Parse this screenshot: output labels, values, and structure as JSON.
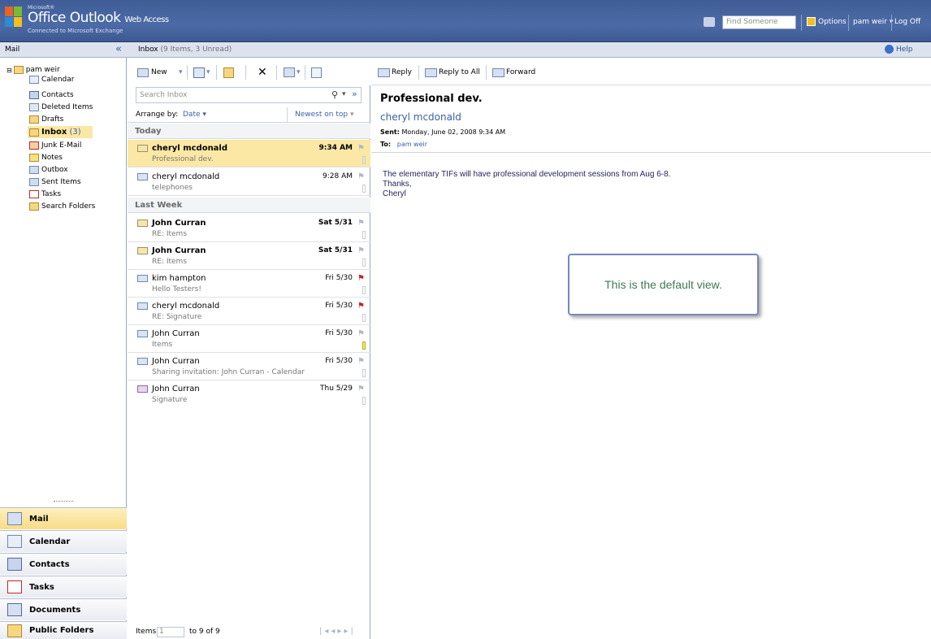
{
  "app": {
    "ms_label": "Microsoft®",
    "title_main": "Office Outlook",
    "title_sub": "Web Access",
    "connected": "Connected to Microsoft Exchange",
    "find_placeholder": "Find Someone",
    "options": "Options",
    "user": "pam weir",
    "logoff": "Log Off",
    "help": "Help"
  },
  "sidebar": {
    "header": "Mail",
    "collapse_glyph": "«",
    "root": "pam weir",
    "folders": [
      {
        "label": "Calendar"
      },
      {
        "label": "Contacts"
      },
      {
        "label": "Deleted Items"
      },
      {
        "label": "Drafts"
      },
      {
        "label": "Inbox",
        "count": "(3)"
      },
      {
        "label": "Junk E-Mail"
      },
      {
        "label": "Notes"
      },
      {
        "label": "Outbox"
      },
      {
        "label": "Sent Items"
      },
      {
        "label": "Tasks"
      },
      {
        "label": "Search Folders"
      }
    ],
    "nav": [
      "Mail",
      "Calendar",
      "Contacts",
      "Tasks",
      "Documents",
      "Public Folders"
    ]
  },
  "list": {
    "title": "Inbox",
    "summary": "(9 Items, 3 Unread)",
    "new_label": "New",
    "search_placeholder": "Search Inbox",
    "arrange_label": "Arrange by:",
    "arrange_value": "Date",
    "order": "Newest on top",
    "groups": [
      "Today",
      "Last Week"
    ],
    "items_label": "Items",
    "items_value": "1",
    "items_range": "to 9 of 9",
    "messages": [
      {
        "from": "cheryl mcdonald",
        "subject": "Professional dev.",
        "date": "9:34 AM"
      },
      {
        "from": "cheryl mcdonald",
        "subject": "telephones",
        "date": "9:28 AM"
      },
      {
        "from": "John Curran",
        "subject": "RE: Items",
        "date": "Sat 5/31"
      },
      {
        "from": "John Curran",
        "subject": "RE: Items",
        "date": "Sat 5/31"
      },
      {
        "from": "kim hampton",
        "subject": "Hello Testers!",
        "date": "Fri 5/30"
      },
      {
        "from": "cheryl mcdonald",
        "subject": "RE: Signature",
        "date": "Fri 5/30"
      },
      {
        "from": "John Curran",
        "subject": "Items",
        "date": "Fri 5/30"
      },
      {
        "from": "John Curran",
        "subject": "Sharing invitation: John Curran - Calendar",
        "date": "Fri 5/30"
      },
      {
        "from": "John Curran",
        "subject": "Signature",
        "date": "Thu 5/29"
      }
    ]
  },
  "reading": {
    "reply": "Reply",
    "reply_all": "Reply to All",
    "forward": "Forward",
    "subject": "Professional dev.",
    "sender": "cheryl mcdonald",
    "sent_label": "Sent:",
    "sent_value": "Monday, June 02, 2008 9:34 AM",
    "to_label": "To:",
    "to_value": "pam weir",
    "body_line1": "The elementary TIFs will have professional development sessions from Aug 6-8.",
    "body_line2": "Thanks,",
    "body_line3": "Cheryl",
    "callout": "This is the default view."
  },
  "colors": {
    "header": "#4c6ba6",
    "selected_row": "#fbe8a5",
    "flag_red": "#c0272d",
    "link": "#3d5fa6"
  }
}
